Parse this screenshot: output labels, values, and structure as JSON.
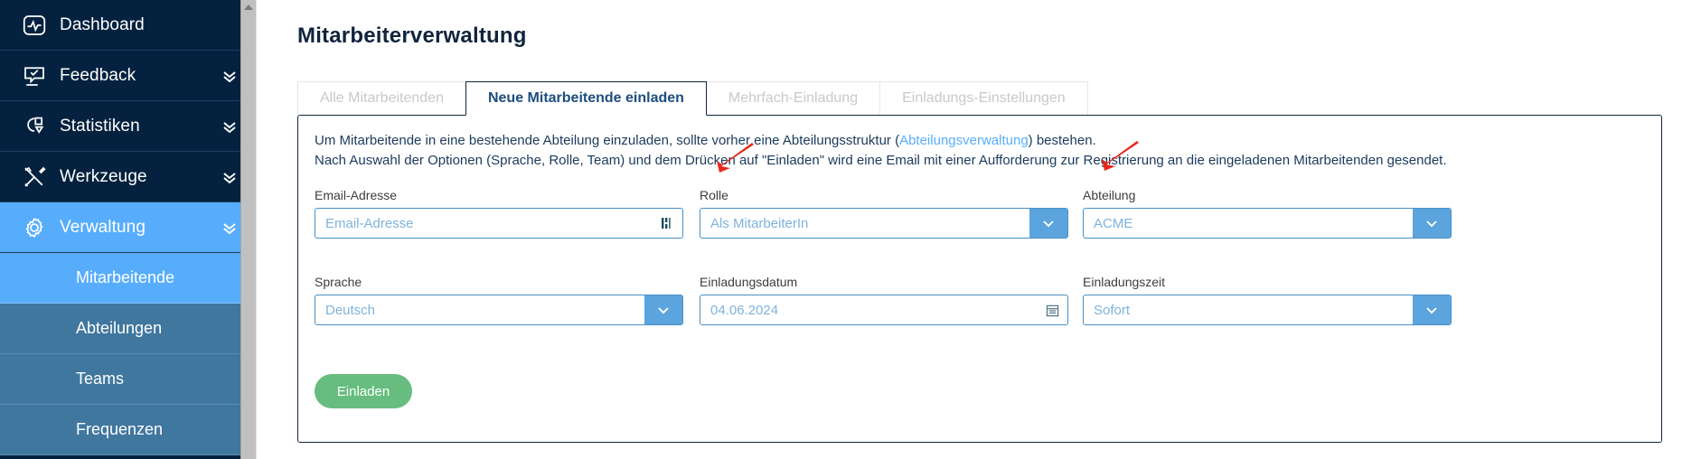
{
  "sidebar": {
    "items": [
      {
        "label": "Dashboard",
        "icon": "dashboard-icon",
        "chevron": false,
        "active": false
      },
      {
        "label": "Feedback",
        "icon": "feedback-icon",
        "chevron": true,
        "active": false
      },
      {
        "label": "Statistiken",
        "icon": "statistics-icon",
        "chevron": true,
        "active": false
      },
      {
        "label": "Werkzeuge",
        "icon": "tools-icon",
        "chevron": true,
        "active": false
      },
      {
        "label": "Verwaltung",
        "icon": "gear-icon",
        "chevron": true,
        "active": true
      }
    ],
    "subitems": [
      {
        "label": "Mitarbeitende",
        "active": true
      },
      {
        "label": "Abteilungen",
        "active": false
      },
      {
        "label": "Teams",
        "active": false
      },
      {
        "label": "Frequenzen",
        "active": false
      }
    ]
  },
  "main": {
    "page_title": "Mitarbeiterverwaltung",
    "tabs": [
      {
        "label": "Alle Mitarbeitenden",
        "active": false
      },
      {
        "label": "Neue Mitarbeitende einladen",
        "active": true
      },
      {
        "label": "Mehrfach-Einladung",
        "active": false
      },
      {
        "label": "Einladungs-Einstellungen",
        "active": false
      }
    ],
    "description": {
      "line1_a": "Um Mitarbeitende in eine bestehende Abteilung einzuladen, sollte vorher eine Abteilungsstruktur (",
      "line1_link": "Abteilungsverwaltung",
      "line1_b": ") bestehen.",
      "line2": "Nach Auswahl der Optionen (Sprache, Rolle, Team) und dem Drücken auf \"Einladen\" wird eine Email mit einer Aufforderung zur Registrierung an die eingeladenen Mitarbeitenden gesendet."
    },
    "fields": {
      "email": {
        "label": "Email-Adresse",
        "value": "Email-Adresse",
        "placeholder": "Email-Adresse"
      },
      "rolle": {
        "label": "Rolle",
        "value": "Als MitarbeiterIn"
      },
      "abteilung": {
        "label": "Abteilung",
        "value": "ACME"
      },
      "sprache": {
        "label": "Sprache",
        "value": "Deutsch"
      },
      "datum": {
        "label": "Einladungsdatum",
        "value": "04.06.2024"
      },
      "zeit": {
        "label": "Einladungszeit",
        "value": "Sofort"
      }
    },
    "invite_button": "Einladen"
  },
  "colors": {
    "sidebar_bg": "#04223f",
    "sidebar_active": "#57adfb",
    "subitem_bg": "#40779f",
    "accent_blue": "#5ba4dd",
    "title_navy": "#10243d",
    "invite_green": "#67bd7f",
    "annotation_red": "#e8281e"
  }
}
